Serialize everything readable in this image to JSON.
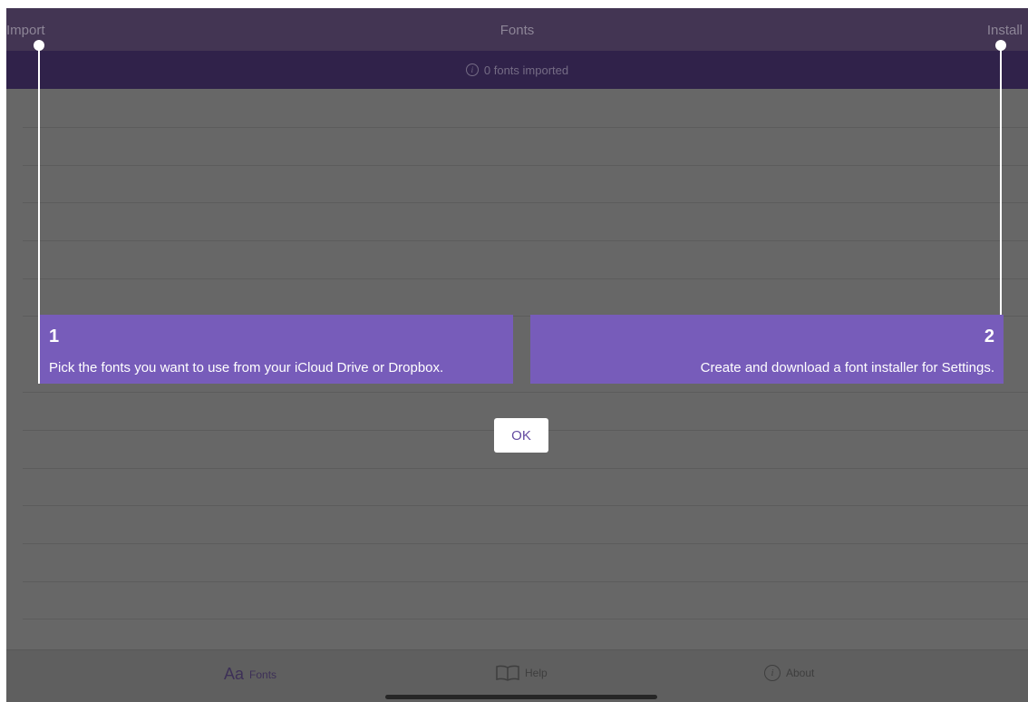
{
  "navbar": {
    "import_label": "Import",
    "title": "Fonts",
    "install_label": "Install"
  },
  "status": {
    "icon": "info-icon",
    "text": "0 fonts imported"
  },
  "onboarding": {
    "step1": {
      "number": "1",
      "text": "Pick the fonts you want to use from your iCloud Drive or Dropbox."
    },
    "step2": {
      "number": "2",
      "text": "Create and download a font installer for Settings."
    },
    "ok_label": "OK"
  },
  "tabbar": {
    "fonts": {
      "icon_text": "Aa",
      "label": "Fonts"
    },
    "help": {
      "icon": "book-icon",
      "label": "Help"
    },
    "about": {
      "icon": "info-icon",
      "label": "About"
    }
  },
  "colors": {
    "accent": "#775cba",
    "navbar": "#433553",
    "status_bar": "#30224a",
    "overlay": "#676767"
  }
}
